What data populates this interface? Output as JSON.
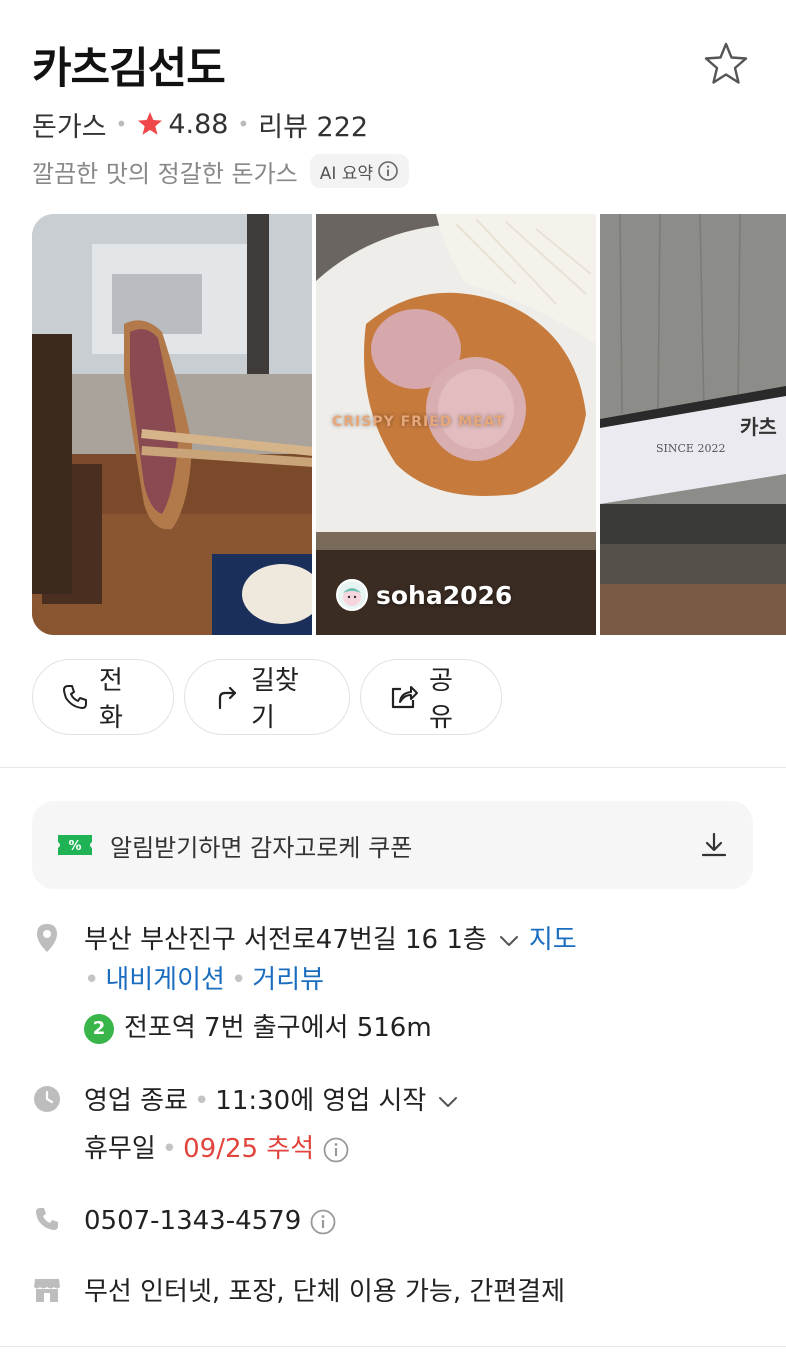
{
  "place": {
    "name": "카츠김선도",
    "category": "돈가스",
    "rating": "4.88",
    "review_label": "리뷰 222",
    "summary": "깔끔한 맛의 정갈한 돈가스",
    "ai_label": "AI 요약"
  },
  "gallery": {
    "overlay_text": "CRISPY FRIED MEAT",
    "uploader": "soha2026",
    "sign_text": "카츠",
    "sign_since": "SINCE 2022"
  },
  "actions": {
    "call": "전화",
    "route": "길찾기",
    "share": "공유"
  },
  "coupon": {
    "badge": "%",
    "text": "알림받기하면 감자고로케 쿠폰"
  },
  "address": {
    "text": "부산 부산진구 서전로47번길 16 1층",
    "map_link": "지도",
    "navigation_link": "내비게이션",
    "streetview_link": "거리뷰",
    "subway_line": "2",
    "subway_text": "전포역 7번 출구에서 516m"
  },
  "hours": {
    "status": "영업 종료",
    "next_open": "11:30에 영업 시작",
    "holiday_label": "휴무일",
    "holiday_value": "09/25 추석"
  },
  "phone": {
    "number": "0507-1343-4579"
  },
  "amenities": {
    "text": "무선 인터넷, 포장, 단체 이용 가능, 간편결제"
  },
  "colors": {
    "link_blue": "#1a6dbf",
    "holiday_red": "#e0443c",
    "rating_star": "#f0474b",
    "subway_line2": "#39b54a",
    "coupon_green": "#1fb356"
  },
  "icons": [
    "star-outline-icon",
    "star-filled-icon",
    "info-icon",
    "phone-icon",
    "route-icon",
    "share-icon",
    "coupon-icon",
    "download-icon",
    "location-pin-icon",
    "chevron-down-icon",
    "clock-icon",
    "store-icon"
  ]
}
